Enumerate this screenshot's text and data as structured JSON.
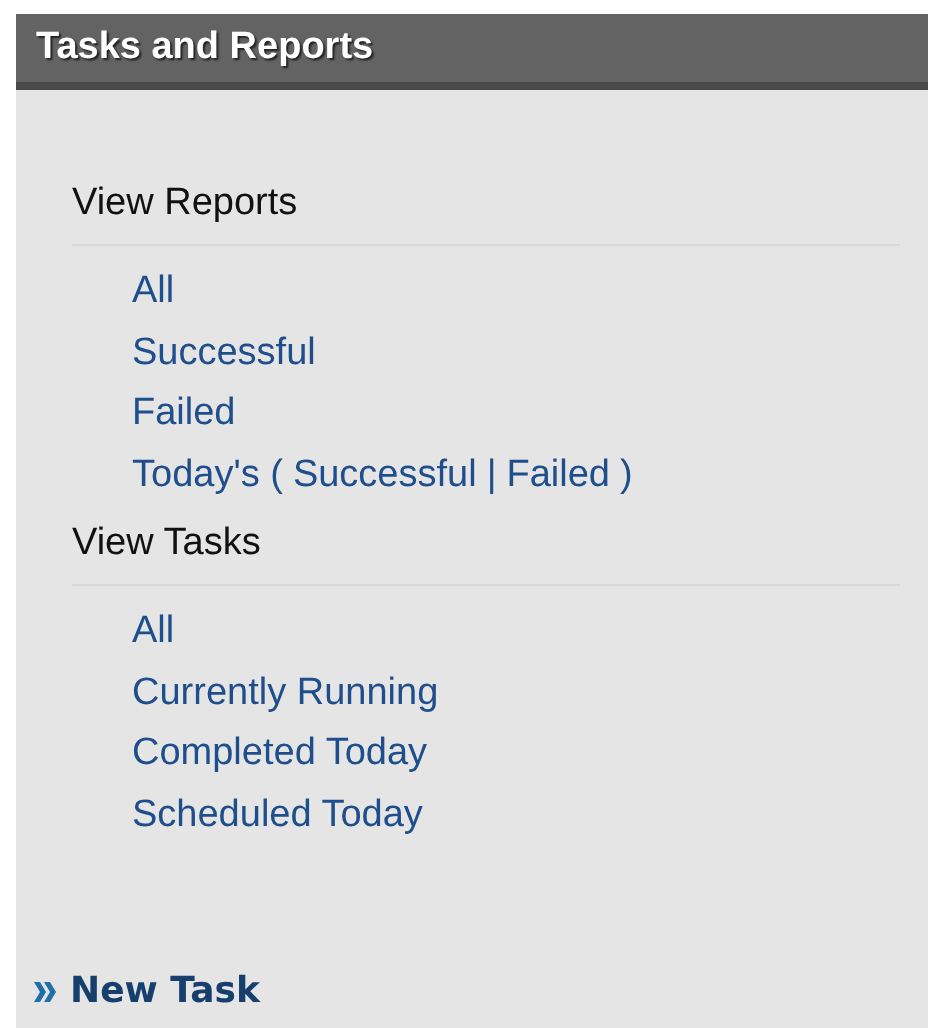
{
  "panel": {
    "title": "Tasks and Reports"
  },
  "sections": [
    {
      "heading": "View Reports",
      "items": [
        {
          "kind": "link",
          "label": "All"
        },
        {
          "kind": "link",
          "label": "Successful"
        },
        {
          "kind": "link",
          "label": "Failed"
        },
        {
          "kind": "compound",
          "prefix": "Today's (",
          "links": [
            "Successful",
            "Failed"
          ],
          "separator": "|",
          "suffix": ")"
        }
      ]
    },
    {
      "heading": "View Tasks",
      "items": [
        {
          "kind": "link",
          "label": "All"
        },
        {
          "kind": "link",
          "label": "Currently Running"
        },
        {
          "kind": "link",
          "label": "Completed Today"
        },
        {
          "kind": "link",
          "label": "Scheduled Today"
        }
      ]
    }
  ],
  "action": {
    "label": "New Task"
  }
}
